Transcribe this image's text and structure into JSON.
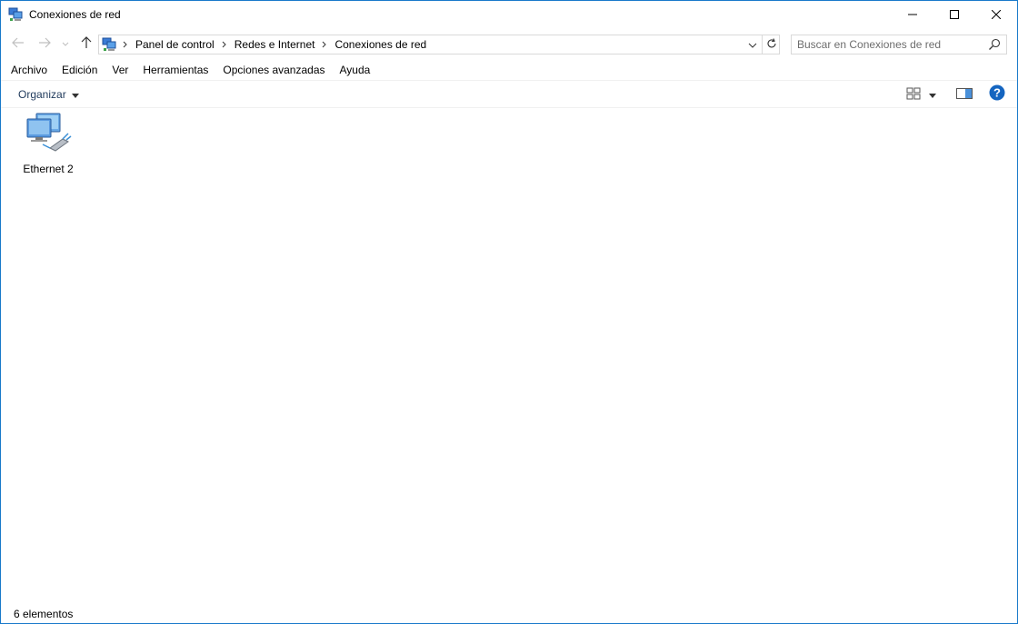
{
  "window": {
    "title": "Conexiones de red",
    "controls": {
      "minimize_icon": "minimize-icon",
      "maximize_icon": "maximize-icon",
      "close_icon": "close-icon"
    }
  },
  "navigation": {
    "back_icon": "arrow-left-icon",
    "forward_icon": "arrow-right-icon",
    "recent_icon": "chevron-down-icon",
    "up_icon": "arrow-up-icon"
  },
  "address": {
    "icon": "network-connections-icon",
    "breadcrumbs": [
      "Panel de control",
      "Redes e Internet",
      "Conexiones de red"
    ],
    "dropdown_icon": "chevron-down-icon",
    "refresh_icon": "refresh-icon"
  },
  "search": {
    "placeholder": "Buscar en Conexiones de red",
    "value": "",
    "icon": "search-icon"
  },
  "menu": {
    "items": [
      "Archivo",
      "Edición",
      "Ver",
      "Herramientas",
      "Opciones avanzadas",
      "Ayuda"
    ]
  },
  "commandbar": {
    "organize_label": "Organizar",
    "view_icon": "view-options-icon",
    "preview_pane_icon": "preview-pane-icon",
    "help_icon": "help-icon"
  },
  "items": [
    {
      "label": "Ethernet 2",
      "icon": "network-adapter-icon"
    }
  ],
  "status": {
    "count_text": "6 elementos"
  },
  "colors": {
    "window_border": "#1979ca",
    "help_blue": "#1565c0",
    "link_text": "#1e395b"
  }
}
